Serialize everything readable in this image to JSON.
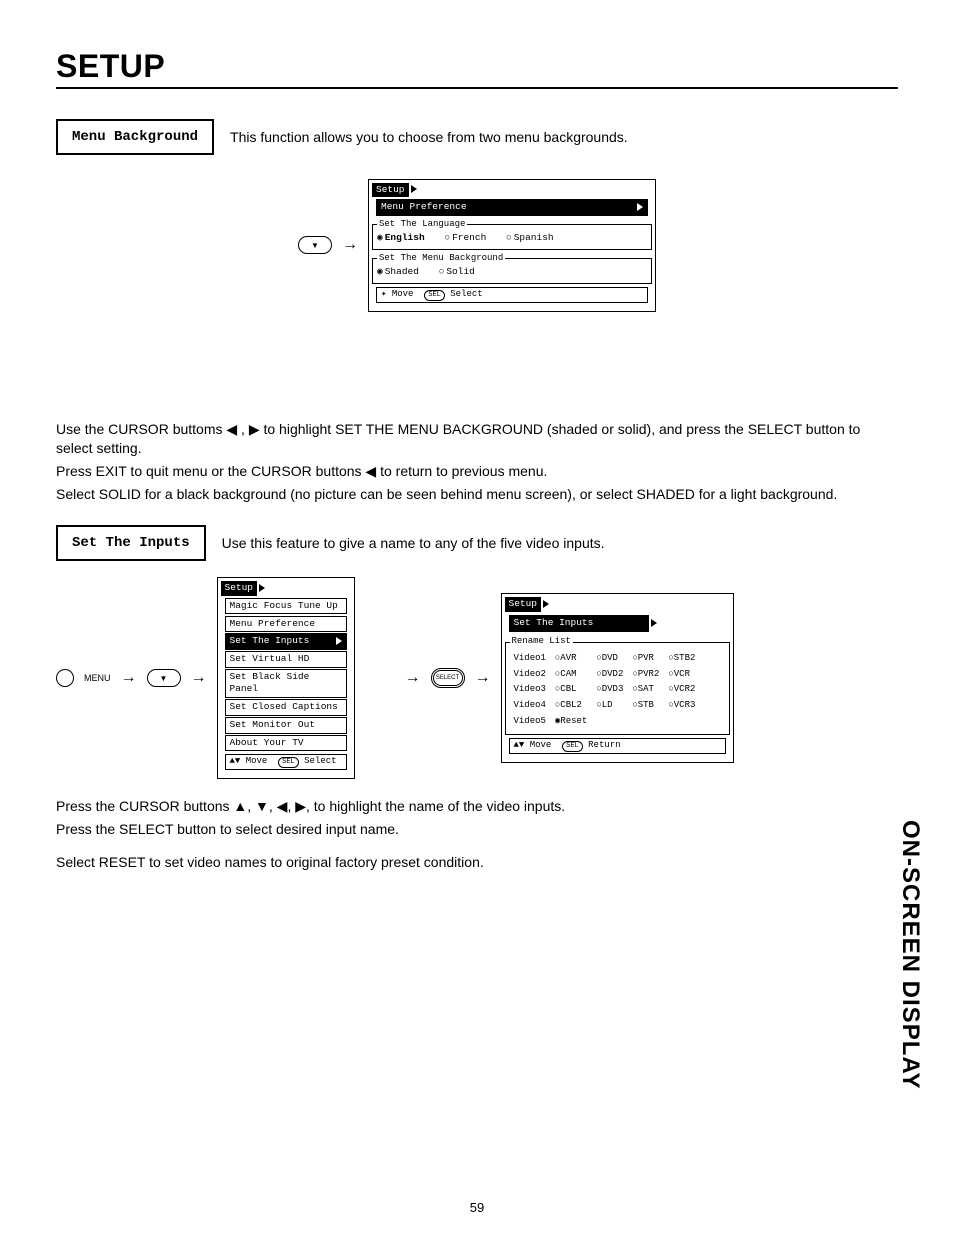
{
  "page": {
    "title": "SETUP",
    "number": "59",
    "side_tab": "ON-SCREEN DISPLAY"
  },
  "section1": {
    "label": "Menu Background",
    "desc": "This function allows you to choose from two menu backgrounds.",
    "osd": {
      "setup": "Setup",
      "menu_pref": "Menu Preference",
      "lang_legend": "Set The Language",
      "lang_opts": {
        "english": "English",
        "french": "French",
        "spanish": "Spanish"
      },
      "bg_legend": "Set The Menu Background",
      "bg_opts": {
        "shaded": "Shaded",
        "solid": "Solid"
      },
      "hint_move": "Move",
      "hint_select": "Select"
    },
    "body1": "Use the CURSOR buttoms ◀ , ▶ to highlight SET THE MENU BACKGROUND (shaded or solid), and press the SELECT button to select setting.",
    "body2": "Press EXIT to quit menu or the CURSOR buttons ◀ to return to previous menu.",
    "body3": "Select SOLID for a black background (no picture can be seen behind menu screen), or select SHADED for a light background."
  },
  "section2": {
    "label": "Set The Inputs",
    "desc": "Use this feature to give a name to any of the five video inputs.",
    "menu_label": "MENU",
    "select_label": "SELECT",
    "osd_left": {
      "setup": "Setup",
      "items": [
        "Magic Focus Tune Up",
        "Menu Preference",
        "Set The Inputs",
        "Set Virtual HD",
        "Set Black Side Panel",
        "Set Closed Captions",
        "Set Monitor Out",
        "About Your TV"
      ],
      "highlight_index": 2,
      "hint_move": "Move",
      "hint_select": "Select"
    },
    "osd_right": {
      "setup": "Setup",
      "sub": "Set The Inputs",
      "rename_legend": "Rename List",
      "rows": [
        {
          "label": "Video1",
          "opts": [
            "AVR",
            "DVD",
            "PVR",
            "STB2"
          ]
        },
        {
          "label": "Video2",
          "opts": [
            "CAM",
            "DVD2",
            "PVR2",
            "VCR"
          ]
        },
        {
          "label": "Video3",
          "opts": [
            "CBL",
            "DVD3",
            "SAT",
            "VCR2"
          ]
        },
        {
          "label": "Video4",
          "opts": [
            "CBL2",
            "LD",
            "STB",
            "VCR3"
          ]
        },
        {
          "label": "Video5",
          "opts": [
            "Reset"
          ],
          "reset_selected": true
        }
      ],
      "hint_move": "Move",
      "hint_return": "Return"
    },
    "body1": "Press the CURSOR buttons ▲, ▼, ◀, ▶, to highlight the name of the video inputs.",
    "body2": "Press the SELECT button to select desired input name.",
    "body3": "Select RESET to set video names to original factory preset condition."
  }
}
